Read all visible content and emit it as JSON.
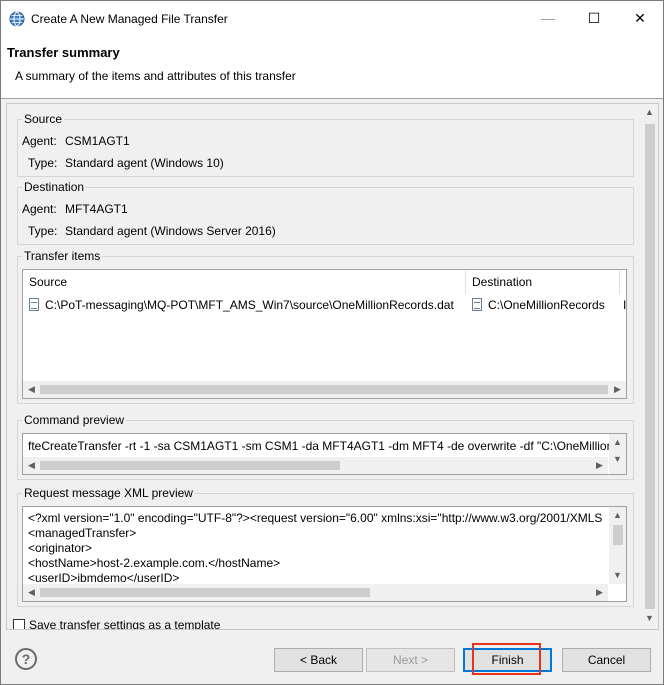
{
  "window": {
    "title": "Create A New Managed File Transfer",
    "minimize_glyph": "—",
    "maximize_glyph": "☐",
    "close_glyph": "✕"
  },
  "banner": {
    "heading": "Transfer summary",
    "description": "A summary of the items and attributes of this transfer"
  },
  "source": {
    "group_title": "Source",
    "agent_label": "Agent:",
    "agent_value": "CSM1AGT1",
    "type_label": "Type:",
    "type_value": "Standard agent (Windows 10)"
  },
  "destination": {
    "group_title": "Destination",
    "agent_label": "Agent:",
    "agent_value": "MFT4AGT1",
    "type_label": "Type:",
    "type_value": "Standard agent (Windows Server 2016)"
  },
  "transfer_items": {
    "group_title": "Transfer items",
    "columns": [
      "Source",
      "Destination",
      "I"
    ],
    "rows": [
      {
        "source": "C:\\PoT-messaging\\MQ-POT\\MFT_AMS_Win7\\source\\OneMillionRecords.dat",
        "destination": "C:\\OneMillionRecords",
        "extra": "I"
      }
    ]
  },
  "command_preview": {
    "group_title": "Command preview",
    "text": "fteCreateTransfer -rt -1 -sa CSM1AGT1 -sm CSM1 -da MFT4AGT1 -dm MFT4 -de overwrite -df \"C:\\OneMillion"
  },
  "xml_preview": {
    "group_title": "Request message XML preview",
    "lines": [
      "<?xml version=\"1.0\" encoding=\"UTF-8\"?><request version=\"6.00\" xmlns:xsi=\"http://www.w3.org/2001/XMLS",
      "  <managedTransfer>",
      "    <originator>",
      "      <hostName>host-2.example.com.</hostName>",
      "      <userID>ibmdemo</userID>"
    ]
  },
  "template_checkbox": {
    "label": "Save transfer settings as a template",
    "checked": false
  },
  "buttons": {
    "back": "< Back",
    "next": "Next >",
    "finish": "Finish",
    "cancel": "Cancel"
  },
  "icons": {
    "app": "globe-transfer-icon",
    "help": "help-icon",
    "file": "file-icon"
  },
  "colors": {
    "accent": "#0078d7",
    "highlight": "#e8341c"
  }
}
